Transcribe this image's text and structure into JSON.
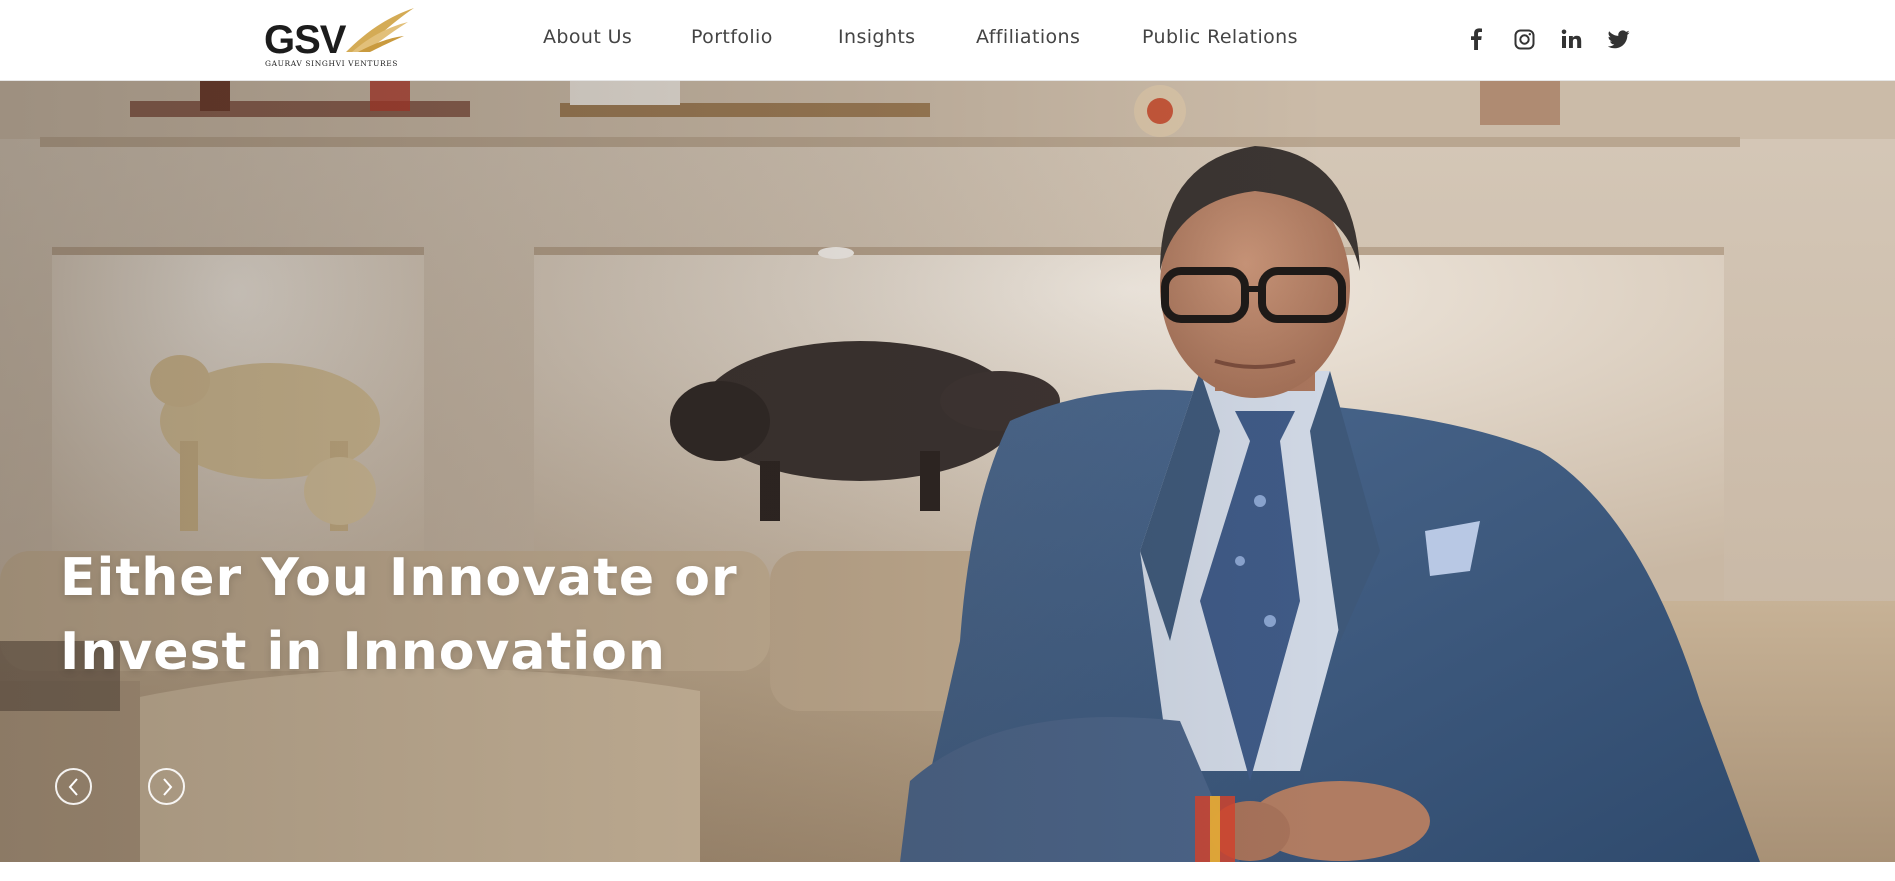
{
  "brand": {
    "logo_text": "GSV",
    "logo_subtext": "GAURAV SINGHVI VENTURES"
  },
  "nav": {
    "items": [
      {
        "label": "About Us"
      },
      {
        "label": "Portfolio"
      },
      {
        "label": "Insights"
      },
      {
        "label": "Affiliations"
      },
      {
        "label": "Public Relations"
      }
    ]
  },
  "social": [
    {
      "icon": "facebook-icon"
    },
    {
      "icon": "instagram-icon"
    },
    {
      "icon": "linkedin-icon"
    },
    {
      "icon": "twitter-icon"
    }
  ],
  "hero": {
    "title_line1": "Either You Innovate or",
    "title_line2": "Invest in Innovation",
    "prev_icon": "chevron-left-icon",
    "next_icon": "chevron-right-icon"
  },
  "colors": {
    "accent_gold": "#c9a24a",
    "nav_text": "#444444",
    "hero_text": "#ffffff"
  }
}
